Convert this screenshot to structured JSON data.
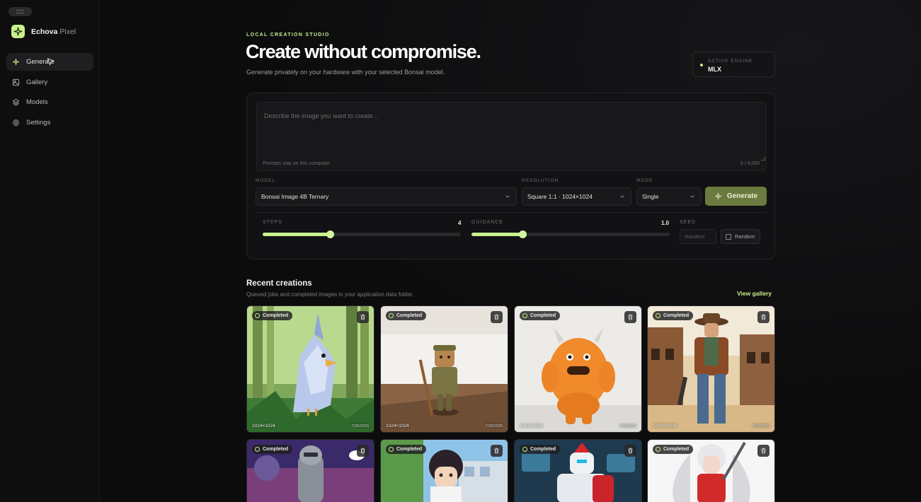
{
  "brand": {
    "name": "Echova",
    "suffix": "Pixel"
  },
  "nav": {
    "items": [
      {
        "label": "Generate",
        "icon": "sparkle-icon",
        "active": true
      },
      {
        "label": "Gallery",
        "icon": "gallery-icon",
        "active": false
      },
      {
        "label": "Models",
        "icon": "layers-icon",
        "active": false
      },
      {
        "label": "Settings",
        "icon": "gear-icon",
        "active": false
      }
    ]
  },
  "header": {
    "eyebrow": "LOCAL CREATION STUDIO",
    "title": "Create without compromise.",
    "subtitle": "Generate privately on your hardware with your selected Bonsai model."
  },
  "engine": {
    "label": "ACTIVE ENGINE",
    "value": "MLX"
  },
  "prompt": {
    "value": "",
    "placeholder": "Describe the image you want to create...",
    "note": "Prompts stay on this computer.",
    "counter": "0 / 4,000"
  },
  "controls": {
    "model": {
      "label": "MODEL",
      "value": "Bonsai Image 4B Ternary"
    },
    "resolution": {
      "label": "RESOLUTION",
      "value": "Square 1:1 · 1024×1024"
    },
    "mode": {
      "label": "MODE",
      "value": "Single"
    },
    "generate_label": "Generate",
    "steps": {
      "label": "STEPS",
      "value": "4",
      "fraction": 0.34
    },
    "guidance": {
      "label": "GUIDANCE",
      "value": "1.0",
      "fraction": 0.26
    },
    "seed": {
      "label": "SEED",
      "placeholder": "Random",
      "random_label": "Random"
    }
  },
  "recent": {
    "title": "Recent creations",
    "subtitle": "Queued jobs and completed images in your application data folder.",
    "view_gallery": "View gallery",
    "cards": [
      {
        "status": "Completed",
        "resolution": "1024×1024",
        "date": "7/28/2026"
      },
      {
        "status": "Completed",
        "resolution": "1024×1024",
        "date": "7/28/2026"
      },
      {
        "status": "Completed",
        "resolution": "1024×1024",
        "date": "7/28/2026"
      },
      {
        "status": "Completed",
        "resolution": "1024×1024",
        "date": "7/28/2026"
      },
      {
        "status": "Completed"
      },
      {
        "status": "Completed"
      },
      {
        "status": "Completed"
      },
      {
        "status": "Completed"
      }
    ]
  },
  "colors": {
    "accent": "#c8f08f",
    "generate_button": "#6b7a3e",
    "background": "#0b0b0c"
  }
}
